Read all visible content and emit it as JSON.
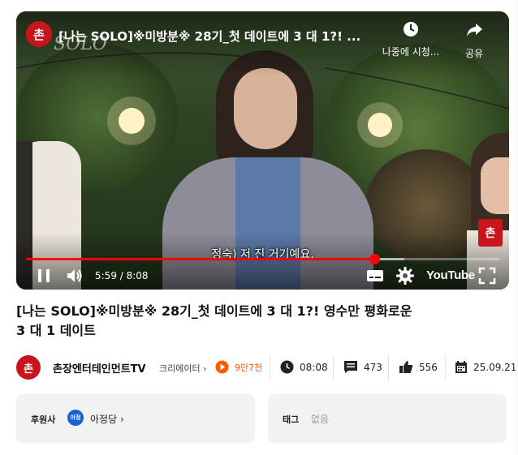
{
  "player": {
    "video_title": "[나는 SOLO]※미방분※ 28기_첫 데이트에 3 대 1?! ...",
    "watermark": "SOLO",
    "channel_logo_text": "촌",
    "watch_later_label": "나중에 시청...",
    "share_label": "공유",
    "corner_logo_text": "촌",
    "subtitle": "정숙) 저 진 거기예요.",
    "current_time": "5:59",
    "duration": "8:08",
    "time_display": "5:59 / 8:08",
    "progress_fraction": 0.736,
    "buffered_fraction": 0.8,
    "youtube_label": "YouTube"
  },
  "video": {
    "title": "[나는 SOLO]※미방분※ 28기_첫 데이트에 3 대 1?! 영수만 평화로운 3 대 1 데이트"
  },
  "meta": {
    "avatar_text": "촌",
    "channel_name": "촌장엔터테인먼트TV",
    "creator_label": "크리에이터",
    "subscribers": "9만7천",
    "length": "08:08",
    "comments": "473",
    "likes": "556",
    "date": "25.09.21"
  },
  "sponsor": {
    "label": "후원사",
    "logo_text": "아정",
    "name": "아정당"
  },
  "tags": {
    "label": "태그",
    "value": "없음"
  },
  "colors": {
    "accent_red": "#ff0000",
    "subscriber_orange": "#ff5a00",
    "brand_red": "#c8141c"
  }
}
